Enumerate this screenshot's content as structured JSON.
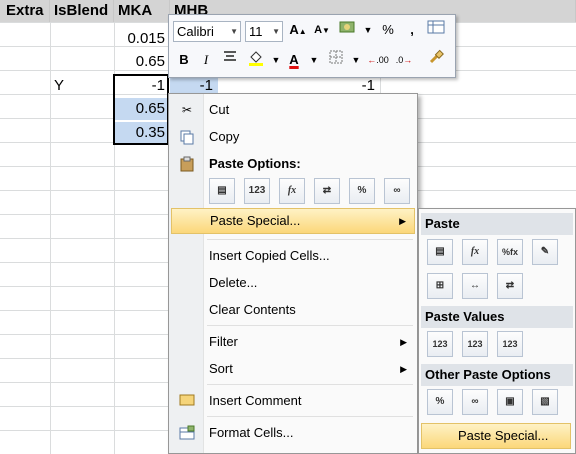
{
  "sheet": {
    "headers": [
      "Extra",
      "IsBlend",
      "MKA",
      "MHB"
    ],
    "rows": [
      {
        "b": "",
        "c": "0.015",
        "d": "",
        "f": ""
      },
      {
        "b": "",
        "c": "0.65",
        "d": "",
        "f": ""
      },
      {
        "b": "Y",
        "c": "-1",
        "d": "-1",
        "f": "-1"
      },
      {
        "b": "",
        "c": "0.65",
        "d": "",
        "f": ""
      },
      {
        "b": "",
        "c": "0.35",
        "d": "",
        "f": ""
      }
    ]
  },
  "mini_toolbar": {
    "font_name": "Calibri",
    "font_size": "11",
    "grow_font": "A",
    "shrink_font": "A",
    "percent": "%",
    "comma": ",",
    "bold": "B",
    "italic": "I",
    "font_color_glyph": "A",
    "inc_decimal": ".00",
    "dec_decimal": ".0"
  },
  "context_menu": {
    "items": {
      "cut": "Cut",
      "copy": "Copy",
      "paste_options": "Paste Options:",
      "paste_special": "Paste Special...",
      "insert_copied_cells": "Insert Copied Cells...",
      "delete": "Delete...",
      "clear_contents": "Clear Contents",
      "filter": "Filter",
      "sort": "Sort",
      "insert_comment": "Insert Comment",
      "format_cells": "Format Cells..."
    },
    "paste_buttons": [
      "",
      "123",
      "fx",
      "",
      "%",
      ""
    ]
  },
  "submenu": {
    "paste_header": "Paste",
    "paste_values_header": "Paste Values",
    "other_header": "Other Paste Options",
    "paste_special": "Paste Special...",
    "paste_buttons": [
      "",
      "fx",
      "%fx",
      ""
    ],
    "paste_buttons2": [
      "",
      "",
      ""
    ],
    "value_buttons": [
      "123",
      "123",
      "123"
    ],
    "other_buttons": [
      "%",
      "",
      "",
      ""
    ]
  }
}
